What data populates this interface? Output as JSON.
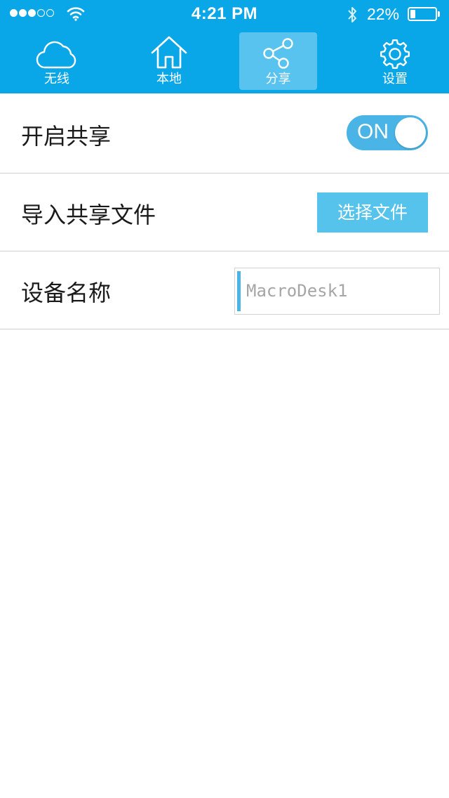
{
  "status_bar": {
    "time": "4:21 PM",
    "battery_percent": "22%",
    "battery_level": 0.22,
    "signal_bars_filled": 3,
    "signal_bars_total": 5
  },
  "nav": {
    "tabs": [
      {
        "label": "无线",
        "icon": "cloud-icon",
        "active": false
      },
      {
        "label": "本地",
        "icon": "home-icon",
        "active": false
      },
      {
        "label": "分享",
        "icon": "share-icon",
        "active": true
      },
      {
        "label": "设置",
        "icon": "gear-icon",
        "active": false
      }
    ]
  },
  "settings": {
    "enable_sharing": {
      "label": "开启共享",
      "toggle_text": "ON",
      "value": true
    },
    "import_files": {
      "label": "导入共享文件",
      "button_label": "选择文件"
    },
    "device_name": {
      "label": "设备名称",
      "placeholder": "MacroDesk1",
      "value": ""
    }
  },
  "colors": {
    "header_background": "#0aa7e8",
    "accent": "#4ab4e6",
    "button": "#56c3ed"
  }
}
